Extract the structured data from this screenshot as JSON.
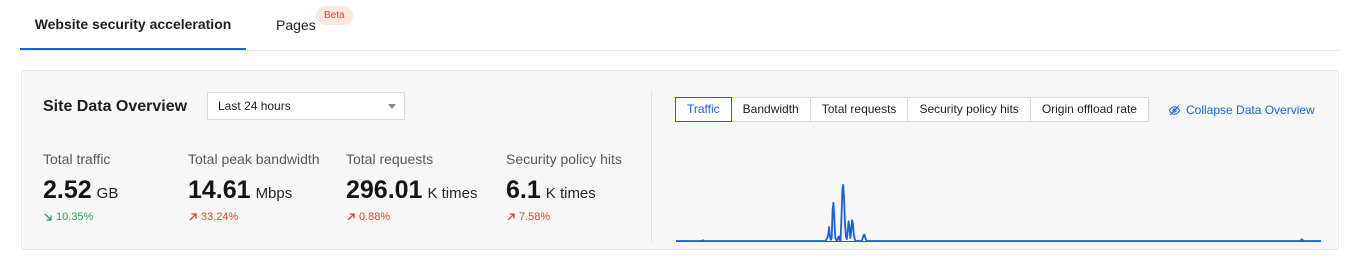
{
  "tabs": {
    "active_label": "Website security acceleration",
    "pages_label": "Pages",
    "beta_badge": "Beta"
  },
  "overview": {
    "title": "Site Data Overview",
    "time_range": "Last 24 hours",
    "metrics": [
      {
        "label": "Total traffic",
        "value": "2.52",
        "unit": "GB",
        "change": "10.35%",
        "direction": "down",
        "color": "#2e9d5c"
      },
      {
        "label": "Total peak bandwidth",
        "value": "14.61",
        "unit": "Mbps",
        "change": "33.24%",
        "direction": "up",
        "color": "#e0432a"
      },
      {
        "label": "Total requests",
        "value": "296.01",
        "unit": "K times",
        "change": "0.88%",
        "direction": "up",
        "color": "#e0432a"
      },
      {
        "label": "Security policy hits",
        "value": "6.1",
        "unit": "K times",
        "change": "7.58%",
        "direction": "up",
        "color": "#e0432a"
      }
    ]
  },
  "chart_tabs": [
    "Traffic",
    "Bandwidth",
    "Total requests",
    "Security policy hits",
    "Origin offload rate"
  ],
  "active_chart_tab": "Traffic",
  "collapse_label": "Collapse Data Overview",
  "colors": {
    "accent": "#1a63e0",
    "line": "#1a5fe0"
  },
  "chart_data": {
    "type": "line",
    "series": [
      {
        "values": [
          0,
          0,
          0,
          0,
          0,
          0,
          0,
          0,
          0,
          0,
          0,
          0,
          0,
          0,
          0,
          0,
          0,
          0,
          0,
          0,
          0,
          0,
          0,
          0,
          0,
          0,
          0,
          0,
          0,
          0,
          0.01,
          0.01,
          0,
          0,
          0,
          0,
          0,
          0,
          0,
          0,
          0,
          0,
          0,
          0,
          0,
          0,
          0,
          0,
          0,
          0,
          0,
          0,
          0,
          0,
          0,
          0,
          0,
          0,
          0,
          0,
          0,
          0,
          0,
          0,
          0,
          0,
          0,
          0,
          0,
          0,
          0,
          0,
          0,
          0,
          0,
          0,
          0,
          0,
          0,
          0,
          0,
          0,
          0,
          0,
          0,
          0,
          0,
          0,
          0,
          0,
          0,
          0,
          0,
          0,
          0,
          0,
          0,
          0,
          0,
          0,
          0,
          0,
          0,
          0,
          0,
          0,
          0,
          0,
          0,
          0,
          0,
          0,
          0,
          0,
          0,
          0,
          0,
          0,
          0,
          0,
          0,
          0,
          0,
          0,
          0,
          0,
          0,
          0,
          0,
          0,
          0,
          0,
          0,
          0,
          0,
          0,
          0,
          0,
          0,
          0,
          0,
          0,
          0,
          0,
          0,
          0,
          0,
          0,
          0,
          0,
          0,
          0,
          0,
          0,
          0,
          0,
          0,
          0,
          0,
          0,
          0,
          0,
          0,
          0,
          0,
          0,
          0,
          0,
          0,
          0,
          0.03,
          0.05,
          0.1,
          0.24,
          0.08,
          0.02,
          0.05,
          0.55,
          0.66,
          0.35,
          0.06,
          0.02,
          0,
          0.05,
          0.08,
          0.02,
          0,
          0.4,
          0.88,
          0.97,
          0.7,
          0.3,
          0.08,
          0.03,
          0.15,
          0.34,
          0.25,
          0.05,
          0.16,
          0.36,
          0.3,
          0.1,
          0.03,
          0,
          0,
          0,
          0,
          0,
          0,
          0,
          0,
          0.05,
          0.1,
          0.11,
          0.05,
          0.01,
          0,
          0,
          0,
          0,
          0,
          0,
          0,
          0,
          0,
          0,
          0,
          0,
          0,
          0,
          0,
          0,
          0,
          0,
          0,
          0,
          0,
          0,
          0,
          0,
          0,
          0,
          0,
          0,
          0,
          0,
          0,
          0,
          0,
          0,
          0,
          0,
          0,
          0,
          0,
          0,
          0,
          0,
          0,
          0,
          0,
          0,
          0,
          0,
          0,
          0,
          0,
          0,
          0,
          0,
          0,
          0,
          0,
          0,
          0,
          0,
          0,
          0,
          0,
          0,
          0,
          0,
          0,
          0,
          0,
          0,
          0,
          0,
          0,
          0,
          0,
          0,
          0,
          0,
          0,
          0,
          0,
          0,
          0,
          0,
          0,
          0,
          0,
          0,
          0,
          0,
          0,
          0,
          0,
          0,
          0,
          0,
          0,
          0,
          0,
          0,
          0,
          0,
          0,
          0,
          0,
          0,
          0,
          0,
          0,
          0,
          0,
          0,
          0,
          0,
          0,
          0,
          0,
          0,
          0,
          0,
          0,
          0,
          0,
          0,
          0,
          0,
          0,
          0,
          0,
          0,
          0,
          0,
          0,
          0,
          0,
          0,
          0,
          0,
          0,
          0,
          0,
          0,
          0,
          0,
          0,
          0,
          0,
          0,
          0,
          0,
          0,
          0,
          0,
          0,
          0,
          0,
          0,
          0,
          0,
          0,
          0,
          0,
          0,
          0,
          0,
          0,
          0,
          0,
          0,
          0,
          0,
          0,
          0,
          0,
          0,
          0,
          0,
          0,
          0,
          0,
          0,
          0,
          0,
          0,
          0,
          0,
          0,
          0,
          0,
          0,
          0,
          0,
          0,
          0,
          0,
          0,
          0,
          0,
          0,
          0,
          0,
          0,
          0,
          0,
          0,
          0,
          0,
          0,
          0,
          0,
          0,
          0,
          0,
          0,
          0,
          0,
          0,
          0,
          0,
          0,
          0,
          0,
          0,
          0,
          0,
          0,
          0,
          0,
          0,
          0,
          0,
          0,
          0,
          0,
          0,
          0,
          0,
          0,
          0,
          0,
          0,
          0,
          0,
          0,
          0,
          0,
          0,
          0,
          0,
          0,
          0,
          0,
          0,
          0,
          0,
          0,
          0,
          0,
          0,
          0,
          0,
          0,
          0,
          0,
          0,
          0,
          0,
          0,
          0,
          0,
          0,
          0,
          0,
          0,
          0,
          0,
          0,
          0,
          0,
          0,
          0,
          0,
          0,
          0,
          0,
          0,
          0,
          0,
          0,
          0,
          0,
          0,
          0,
          0,
          0,
          0,
          0,
          0,
          0,
          0,
          0,
          0,
          0,
          0,
          0,
          0,
          0,
          0,
          0,
          0,
          0,
          0,
          0,
          0,
          0,
          0,
          0,
          0,
          0,
          0,
          0,
          0,
          0,
          0,
          0,
          0,
          0,
          0,
          0,
          0,
          0,
          0,
          0,
          0,
          0,
          0,
          0,
          0,
          0,
          0,
          0,
          0,
          0,
          0,
          0,
          0,
          0,
          0,
          0,
          0,
          0,
          0,
          0,
          0,
          0,
          0,
          0,
          0,
          0,
          0,
          0,
          0,
          0,
          0,
          0,
          0,
          0,
          0,
          0,
          0,
          0,
          0,
          0,
          0,
          0,
          0,
          0,
          0,
          0,
          0,
          0,
          0,
          0,
          0,
          0,
          0,
          0,
          0,
          0,
          0,
          0,
          0,
          0,
          0,
          0,
          0,
          0,
          0,
          0,
          0,
          0,
          0,
          0,
          0,
          0,
          0,
          0,
          0,
          0,
          0,
          0,
          0,
          0,
          0,
          0,
          0,
          0,
          0,
          0,
          0,
          0,
          0,
          0,
          0,
          0,
          0,
          0,
          0,
          0,
          0,
          0,
          0,
          0,
          0,
          0,
          0,
          0,
          0,
          0,
          0,
          0,
          0,
          0,
          0,
          0,
          0,
          0,
          0,
          0,
          0,
          0,
          0,
          0,
          0,
          0,
          0,
          0,
          0,
          0,
          0,
          0,
          0,
          0,
          0,
          0,
          0,
          0,
          0,
          0,
          0,
          0,
          0,
          0,
          0,
          0,
          0,
          0,
          0,
          0,
          0,
          0,
          0,
          0,
          0,
          0,
          0,
          0,
          0,
          0,
          0,
          0,
          0.03,
          0.02,
          0,
          0,
          0,
          0,
          0,
          0,
          0,
          0,
          0,
          0,
          0,
          0,
          0,
          0,
          0,
          0,
          0,
          0,
          0,
          0,
          0
        ]
      }
    ],
    "ylim": [
      0,
      1
    ],
    "grid": false
  }
}
